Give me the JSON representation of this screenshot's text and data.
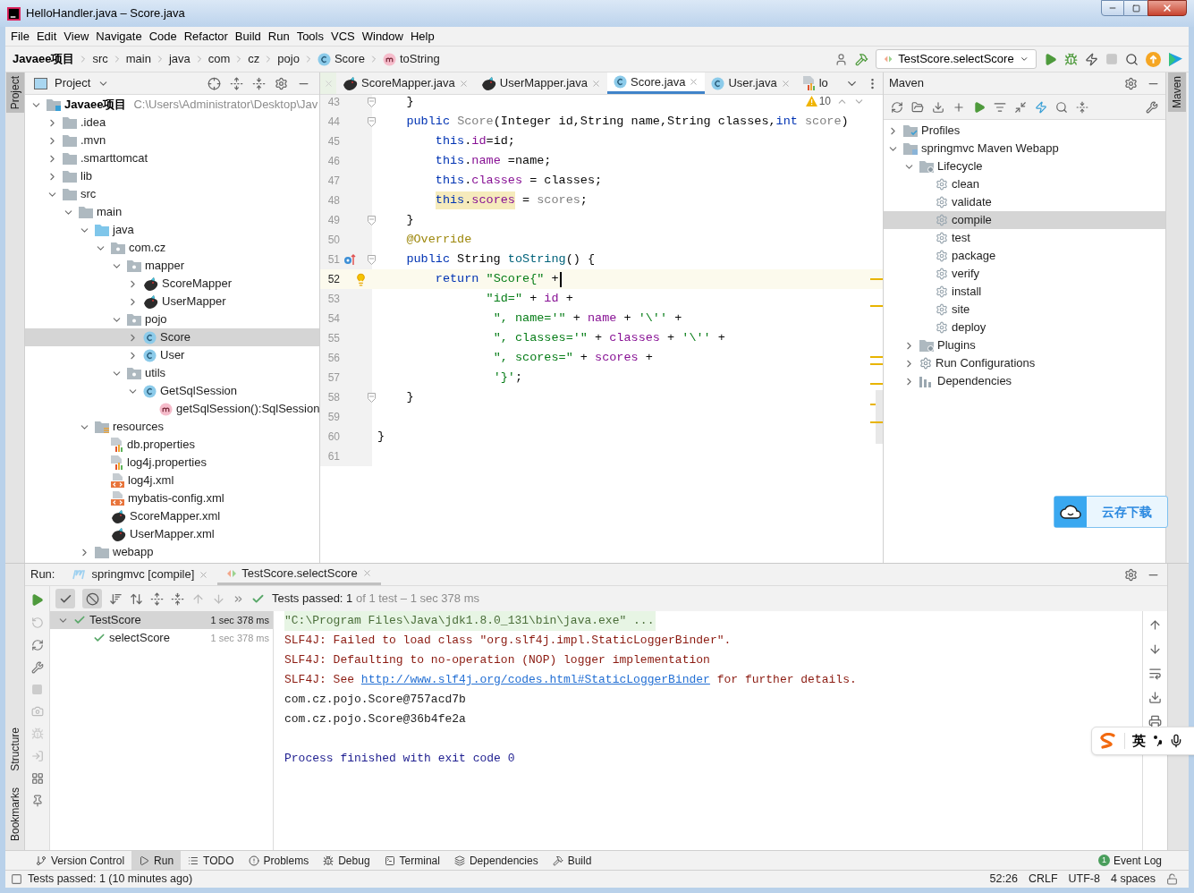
{
  "window": {
    "title": "HelloHandler.java – Score.java"
  },
  "menu": [
    "File",
    "Edit",
    "View",
    "Navigate",
    "Code",
    "Refactor",
    "Build",
    "Run",
    "Tools",
    "VCS",
    "Window",
    "Help"
  ],
  "breadcrumbs": [
    {
      "label": "Javaee项目",
      "kind": "project"
    },
    {
      "label": "src",
      "kind": "plain"
    },
    {
      "label": "main",
      "kind": "plain"
    },
    {
      "label": "java",
      "kind": "plain"
    },
    {
      "label": "com",
      "kind": "plain"
    },
    {
      "label": "cz",
      "kind": "plain"
    },
    {
      "label": "pojo",
      "kind": "plain"
    },
    {
      "label": "Score",
      "kind": "class"
    },
    {
      "label": "toString",
      "kind": "method"
    }
  ],
  "run_config": "TestScore.selectScore",
  "left_stripe": {
    "top": [
      {
        "label": "Project",
        "selected": true
      }
    ],
    "bottom": [
      {
        "label": "Structure",
        "selected": false
      },
      {
        "label": "Bookmarks",
        "selected": false
      }
    ]
  },
  "right_stripe": [
    {
      "label": "Maven",
      "selected": true
    }
  ],
  "project_panel": {
    "title": "Project",
    "tree": [
      {
        "label": "Javaee项目",
        "hint": "C:\\Users\\Administrator\\Desktop\\Jav",
        "kind": "module",
        "expanded": true,
        "selected": false,
        "children": [
          {
            "label": ".idea",
            "kind": "folder",
            "expanded": false,
            "selected": false
          },
          {
            "label": ".mvn",
            "kind": "folder",
            "expanded": false,
            "selected": false
          },
          {
            "label": ".smarttomcat",
            "kind": "folder",
            "expanded": false,
            "selected": false
          },
          {
            "label": "lib",
            "kind": "folder",
            "expanded": false,
            "selected": false
          },
          {
            "label": "src",
            "kind": "folder",
            "expanded": true,
            "selected": false,
            "children": [
              {
                "label": "main",
                "kind": "folder",
                "expanded": true,
                "selected": false,
                "children": [
                  {
                    "label": "java",
                    "kind": "source-folder",
                    "expanded": true,
                    "selected": false,
                    "children": [
                      {
                        "label": "com.cz",
                        "kind": "package",
                        "expanded": true,
                        "selected": false,
                        "children": [
                          {
                            "label": "mapper",
                            "kind": "package",
                            "expanded": true,
                            "selected": false,
                            "children": [
                              {
                                "label": "ScoreMapper",
                                "kind": "mapper",
                                "expanded": false,
                                "selected": false
                              },
                              {
                                "label": "UserMapper",
                                "kind": "mapper",
                                "expanded": false,
                                "selected": false
                              }
                            ]
                          },
                          {
                            "label": "pojo",
                            "kind": "package",
                            "expanded": true,
                            "selected": false,
                            "children": [
                              {
                                "label": "Score",
                                "kind": "class",
                                "expanded": false,
                                "selected": true
                              },
                              {
                                "label": "User",
                                "kind": "class",
                                "expanded": false,
                                "selected": false
                              }
                            ]
                          },
                          {
                            "label": "utils",
                            "kind": "package",
                            "expanded": true,
                            "selected": false,
                            "children": [
                              {
                                "label": "GetSqlSession",
                                "kind": "class",
                                "expanded": true,
                                "selected": false,
                                "children": [
                                  {
                                    "label": "getSqlSession():SqlSession",
                                    "kind": "method",
                                    "selected": false
                                  }
                                ]
                              }
                            ]
                          }
                        ]
                      }
                    ]
                  },
                  {
                    "label": "resources",
                    "kind": "resources",
                    "expanded": true,
                    "selected": false,
                    "children": [
                      {
                        "label": "db.properties",
                        "kind": "properties",
                        "selected": false
                      },
                      {
                        "label": "log4j.properties",
                        "kind": "properties",
                        "selected": false
                      },
                      {
                        "label": "log4j.xml",
                        "kind": "xml",
                        "selected": false
                      },
                      {
                        "label": "mybatis-config.xml",
                        "kind": "xml",
                        "selected": false
                      },
                      {
                        "label": "ScoreMapper.xml",
                        "kind": "mapper",
                        "selected": false
                      },
                      {
                        "label": "UserMapper.xml",
                        "kind": "mapper",
                        "selected": false
                      }
                    ]
                  },
                  {
                    "label": "webapp",
                    "kind": "folder",
                    "expanded": false,
                    "selected": false
                  }
                ]
              }
            ]
          }
        ]
      }
    ]
  },
  "editor": {
    "tabs": [
      {
        "label": "ScoreMapper.java",
        "kind": "mapper",
        "selected": false,
        "closable": true
      },
      {
        "label": "UserMapper.java",
        "kind": "mapper",
        "selected": false,
        "closable": true
      },
      {
        "label": "Score.java",
        "kind": "class",
        "selected": true,
        "closable": true
      },
      {
        "label": "User.java",
        "kind": "class",
        "selected": false,
        "closable": true
      },
      {
        "label": "lo",
        "kind": "properties",
        "selected": false,
        "closable": false
      }
    ],
    "warnings": "10",
    "lines": [
      {
        "number": "43",
        "fold": true,
        "current": false,
        "tokens": [
          {
            "t": "    }",
            "kind": "plain"
          }
        ]
      },
      {
        "number": "44",
        "fold": true,
        "current": false,
        "tokens": [
          {
            "t": "    public ",
            "kind": "kw"
          },
          {
            "t": "Score",
            "kind": "unused"
          },
          {
            "t": "(Integer id,String name,String classes,",
            "kind": "plain"
          },
          {
            "t": "int ",
            "kind": "kw"
          },
          {
            "t": "score",
            "kind": "unused"
          },
          {
            "t": ")",
            "kind": "plain"
          }
        ]
      },
      {
        "number": "45",
        "fold": false,
        "current": false,
        "tokens": [
          {
            "t": "        this",
            "kind": "kw"
          },
          {
            "t": ".",
            "kind": "plain"
          },
          {
            "t": "id",
            "kind": "field"
          },
          {
            "t": "=id;",
            "kind": "plain"
          }
        ]
      },
      {
        "number": "46",
        "fold": false,
        "current": false,
        "tokens": [
          {
            "t": "        this",
            "kind": "kw"
          },
          {
            "t": ".",
            "kind": "plain"
          },
          {
            "t": "name",
            "kind": "field"
          },
          {
            "t": " =name;",
            "kind": "plain"
          }
        ]
      },
      {
        "number": "47",
        "fold": false,
        "current": false,
        "tokens": [
          {
            "t": "        this",
            "kind": "kw"
          },
          {
            "t": ".",
            "kind": "plain"
          },
          {
            "t": "classes",
            "kind": "field"
          },
          {
            "t": " = classes;",
            "kind": "plain"
          }
        ]
      },
      {
        "number": "48",
        "fold": false,
        "current": false,
        "tokens": [
          {
            "t": "        this",
            "kind": "kw-hl"
          },
          {
            "t": ".",
            "kind": "plain-hl"
          },
          {
            "t": "scores",
            "kind": "field-hl"
          },
          {
            "t": " = ",
            "kind": "plain"
          },
          {
            "t": "scores",
            "kind": "unused"
          },
          {
            "t": ";",
            "kind": "plain"
          }
        ]
      },
      {
        "number": "49",
        "fold": true,
        "current": false,
        "tokens": [
          {
            "t": "    }",
            "kind": "plain"
          }
        ]
      },
      {
        "number": "50",
        "fold": false,
        "current": false,
        "tokens": [
          {
            "t": "    @Override",
            "kind": "ann"
          }
        ]
      },
      {
        "number": "51",
        "fold": true,
        "current": false,
        "kind": "override",
        "tokens": [
          {
            "t": "    public",
            "kind": "kw"
          },
          {
            "t": " String ",
            "kind": "plain"
          },
          {
            "t": "toString",
            "kind": "method"
          },
          {
            "t": "() {",
            "kind": "plain"
          }
        ]
      },
      {
        "number": "52",
        "fold": false,
        "current": true,
        "kind": "bulb",
        "tokens": [
          {
            "t": "        return ",
            "kind": "kw"
          },
          {
            "t": "\"Score{\"",
            "kind": "str"
          },
          {
            "t": " +",
            "kind": "plain"
          }
        ]
      },
      {
        "number": "53",
        "fold": false,
        "current": false,
        "tokens": [
          {
            "t": "               \"id=\"",
            "kind": "str"
          },
          {
            "t": " + ",
            "kind": "plain"
          },
          {
            "t": "id",
            "kind": "field"
          },
          {
            "t": " +",
            "kind": "plain"
          }
        ]
      },
      {
        "number": "54",
        "fold": false,
        "current": false,
        "tokens": [
          {
            "t": "                \", name='\"",
            "kind": "str"
          },
          {
            "t": " + ",
            "kind": "plain"
          },
          {
            "t": "name",
            "kind": "field"
          },
          {
            "t": " + ",
            "kind": "plain"
          },
          {
            "t": "'\\''",
            "kind": "str"
          },
          {
            "t": " +",
            "kind": "plain"
          }
        ]
      },
      {
        "number": "55",
        "fold": false,
        "current": false,
        "tokens": [
          {
            "t": "                \", classes='\"",
            "kind": "str"
          },
          {
            "t": " + ",
            "kind": "plain"
          },
          {
            "t": "classes",
            "kind": "field"
          },
          {
            "t": " + ",
            "kind": "plain"
          },
          {
            "t": "'\\''",
            "kind": "str"
          },
          {
            "t": " +",
            "kind": "plain"
          }
        ]
      },
      {
        "number": "56",
        "fold": false,
        "current": false,
        "tokens": [
          {
            "t": "                \", scores=\"",
            "kind": "str"
          },
          {
            "t": " + ",
            "kind": "plain"
          },
          {
            "t": "scores",
            "kind": "field"
          },
          {
            "t": " +",
            "kind": "plain"
          }
        ]
      },
      {
        "number": "57",
        "fold": false,
        "current": false,
        "tokens": [
          {
            "t": "                '}'",
            "kind": "str"
          },
          {
            "t": ";",
            "kind": "plain"
          }
        ]
      },
      {
        "number": "58",
        "fold": true,
        "current": false,
        "tokens": [
          {
            "t": "    }",
            "kind": "plain"
          }
        ]
      },
      {
        "number": "59",
        "fold": false,
        "current": false
      },
      {
        "number": "60",
        "fold": false,
        "current": false,
        "tokens": [
          {
            "t": "}",
            "kind": "plain"
          }
        ]
      },
      {
        "number": "61",
        "fold": false,
        "current": false
      }
    ]
  },
  "maven_panel": {
    "title": "Maven",
    "tree": [
      {
        "label": "Profiles",
        "kind": "profiles",
        "expanded": false,
        "selected": false
      },
      {
        "label": "springmvc Maven Webapp",
        "kind": "maven-project",
        "expanded": true,
        "selected": false,
        "children": [
          {
            "label": "Lifecycle",
            "kind": "lifecycle",
            "expanded": true,
            "selected": false,
            "children": [
              {
                "label": "clean",
                "kind": "goal",
                "selected": false
              },
              {
                "label": "validate",
                "kind": "goal",
                "selected": false
              },
              {
                "label": "compile",
                "kind": "goal",
                "selected": true
              },
              {
                "label": "test",
                "kind": "goal",
                "selected": false
              },
              {
                "label": "package",
                "kind": "goal",
                "selected": false
              },
              {
                "label": "verify",
                "kind": "goal",
                "selected": false
              },
              {
                "label": "install",
                "kind": "goal",
                "selected": false
              },
              {
                "label": "site",
                "kind": "goal",
                "selected": false
              },
              {
                "label": "deploy",
                "kind": "goal",
                "selected": false
              }
            ]
          },
          {
            "label": "Plugins",
            "kind": "lifecycle",
            "expanded": false,
            "selected": false
          },
          {
            "label": "Run Configurations",
            "kind": "run-configs",
            "expanded": false,
            "selected": false
          },
          {
            "label": "Dependencies",
            "kind": "dependencies",
            "expanded": false,
            "selected": false
          }
        ]
      }
    ]
  },
  "run_panel": {
    "label": "Run:",
    "tabs": [
      {
        "label": "springmvc [compile]",
        "kind": "maven",
        "selected": false
      },
      {
        "label": "TestScore.selectScore",
        "kind": "test",
        "selected": true
      }
    ],
    "filters": [
      {
        "kind": "show-passed",
        "on": true
      },
      {
        "kind": "show-ignored",
        "on": true
      }
    ],
    "status": {
      "passed": "Tests passed: 1",
      "rest": "of 1 test – 1 sec 378 ms"
    },
    "tests": [
      {
        "label": "TestScore",
        "time": "1 sec 378 ms",
        "selected": true,
        "expanded": true,
        "children": [
          {
            "label": "selectScore",
            "time": "1 sec 378 ms",
            "selected": false
          }
        ]
      }
    ],
    "console": [
      {
        "kind": "command",
        "text": "\"C:\\Program Files\\Java\\jdk1.8.0_131\\bin\\java.exe\" ..."
      },
      {
        "kind": "error",
        "text": "SLF4J: Failed to load class \"org.slf4j.impl.StaticLoggerBinder\"."
      },
      {
        "kind": "error",
        "text": "SLF4J: Defaulting to no-operation (NOP) logger implementation"
      },
      {
        "kind": "error",
        "text": "SLF4J: See ",
        "link": "http://www.slf4j.org/codes.html#StaticLoggerBinder",
        "after": " for further details."
      },
      {
        "kind": "output",
        "text": "com.cz.pojo.Score@757acd7b"
      },
      {
        "kind": "output",
        "text": "com.cz.pojo.Score@36b4fe2a"
      },
      {
        "kind": "blank"
      },
      {
        "kind": "exit",
        "text": "Process finished with exit code 0"
      }
    ]
  },
  "tool_windows": [
    {
      "label": "Version Control",
      "kind": "vcs",
      "selected": false
    },
    {
      "label": "Run",
      "kind": "run",
      "selected": true
    },
    {
      "label": "TODO",
      "kind": "todo",
      "selected": false
    },
    {
      "label": "Problems",
      "kind": "problems",
      "selected": false
    },
    {
      "label": "Debug",
      "kind": "debug",
      "selected": false
    },
    {
      "label": "Terminal",
      "kind": "terminal",
      "selected": false
    },
    {
      "label": "Dependencies",
      "kind": "dependencies",
      "selected": false
    },
    {
      "label": "Build",
      "kind": "build",
      "selected": false
    }
  ],
  "event_log": {
    "label": "Event Log",
    "count": "1"
  },
  "status_bar": {
    "message": "Tests passed: 1 (10 minutes ago)",
    "items": [
      "52:26",
      "CRLF",
      "UTF-8",
      "4 spaces"
    ]
  },
  "cloud_button": {
    "label": "云存下载"
  },
  "ime_bar": {
    "mode": "英"
  }
}
